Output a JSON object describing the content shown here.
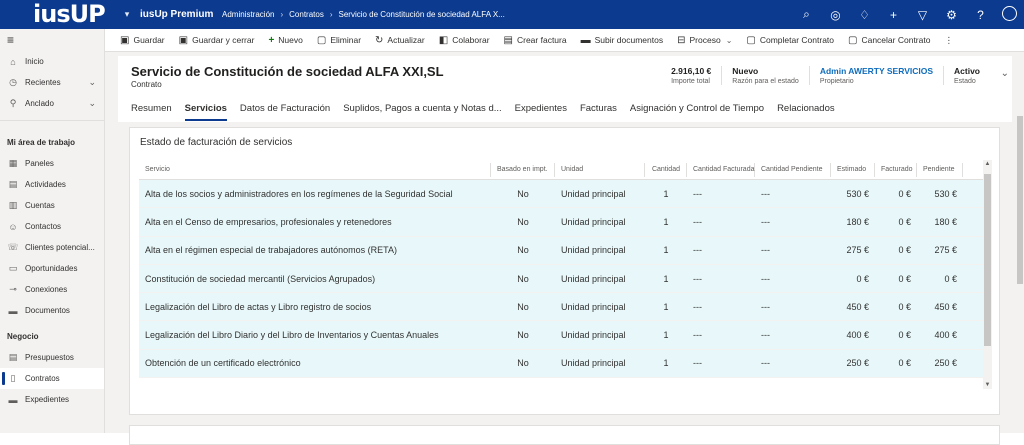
{
  "topbar": {
    "logo": "iusUP",
    "app_name": "iusUp Premium",
    "breadcrumbs": [
      "Administración",
      "Contratos",
      "Servicio de Constitución de sociedad ALFA X..."
    ],
    "icons": [
      "search-icon",
      "target-icon",
      "lightbulb-icon",
      "plus-icon",
      "filter-icon",
      "gear-icon",
      "help-icon",
      "user-icon"
    ]
  },
  "sidebar": {
    "top_items": [
      {
        "label": "Inicio",
        "icon": "home-icon"
      },
      {
        "label": "Recientes",
        "icon": "clock-icon",
        "chevron": true
      },
      {
        "label": "Anclado",
        "icon": "pin-icon",
        "chevron": true
      }
    ],
    "section1": "Mi área de trabajo",
    "work_items": [
      {
        "label": "Paneles",
        "icon": "dashboard-icon"
      },
      {
        "label": "Actividades",
        "icon": "activity-icon"
      },
      {
        "label": "Cuentas",
        "icon": "building-icon"
      },
      {
        "label": "Contactos",
        "icon": "person-icon"
      },
      {
        "label": "Clientes potencial...",
        "icon": "phone-icon"
      },
      {
        "label": "Oportunidades",
        "icon": "document-icon"
      },
      {
        "label": "Conexiones",
        "icon": "connection-icon"
      },
      {
        "label": "Documentos",
        "icon": "folder-icon"
      }
    ],
    "section2": "Negocio",
    "business_items": [
      {
        "label": "Presupuestos",
        "icon": "quote-icon"
      },
      {
        "label": "Contratos",
        "icon": "contract-icon",
        "active": true
      },
      {
        "label": "Expedientes",
        "icon": "folder-icon"
      }
    ]
  },
  "commandbar": [
    {
      "label": "Guardar",
      "icon": "save-icon"
    },
    {
      "label": "Guardar y cerrar",
      "icon": "save-close-icon"
    },
    {
      "label": "Nuevo",
      "icon": "plus-icon"
    },
    {
      "label": "Eliminar",
      "icon": "trash-icon"
    },
    {
      "label": "Actualizar",
      "icon": "refresh-icon"
    },
    {
      "label": "Colaborar",
      "icon": "teams-icon"
    },
    {
      "label": "Crear factura",
      "icon": "invoice-icon"
    },
    {
      "label": "Subir documentos",
      "icon": "upload-icon"
    },
    {
      "label": "Proceso",
      "icon": "process-icon",
      "chevron": true
    },
    {
      "label": "Completar Contrato",
      "icon": "complete-icon"
    },
    {
      "label": "Cancelar Contrato",
      "icon": "cancel-icon"
    }
  ],
  "record": {
    "title": "Servicio de Constitución de sociedad ALFA XXI,SL",
    "entity": "Contrato",
    "kpis": [
      {
        "value": "2.916,10 €",
        "label": "Importe total",
        "link": false
      },
      {
        "value": "Nuevo",
        "label": "Razón para el estado",
        "link": false
      },
      {
        "value": "Admin AWERTY SERVICIOS",
        "label": "Propietario",
        "link": true
      },
      {
        "value": "Activo",
        "label": "Estado",
        "link": false
      }
    ]
  },
  "tabs": [
    "Resumen",
    "Servicios",
    "Datos de Facturación",
    "Suplidos, Pagos a cuenta y Notas d...",
    "Expedientes",
    "Facturas",
    "Asignación y Control de Tiempo",
    "Relacionados"
  ],
  "active_tab": "Servicios",
  "grid": {
    "title": "Estado de facturación de servicios",
    "columns": [
      "Servicio",
      "Basado en impt.",
      "Unidad",
      "Cantidad",
      "Cantidad Facturada",
      "Cantidad Pendiente",
      "Estimado",
      "Facturado",
      "Pendiente"
    ],
    "rows": [
      [
        "Alta de los socios y administradores en los regímenes de la Seguridad Social",
        "No",
        "Unidad principal",
        "1",
        "---",
        "---",
        "530 €",
        "0 €",
        "530 €"
      ],
      [
        "Alta en el Censo de empresarios, profesionales y retenedores",
        "No",
        "Unidad principal",
        "1",
        "---",
        "---",
        "180 €",
        "0 €",
        "180 €"
      ],
      [
        "Alta en el régimen especial de trabajadores autónomos (RETA)",
        "No",
        "Unidad principal",
        "1",
        "---",
        "---",
        "275 €",
        "0 €",
        "275 €"
      ],
      [
        "Constitución de sociedad mercantil (Servicios Agrupados)",
        "No",
        "Unidad principal",
        "1",
        "---",
        "---",
        "0 €",
        "0 €",
        "0 €"
      ],
      [
        "Legalización del Libro de actas y Libro registro de socios",
        "No",
        "Unidad principal",
        "1",
        "---",
        "---",
        "450 €",
        "0 €",
        "450 €"
      ],
      [
        "Legalización del Libro Diario y del Libro de Inventarios y Cuentas Anuales",
        "No",
        "Unidad principal",
        "1",
        "---",
        "---",
        "400 €",
        "0 €",
        "400 €"
      ],
      [
        "Obtención de un certificado electrónico",
        "No",
        "Unidad principal",
        "1",
        "---",
        "---",
        "250 €",
        "0 €",
        "250 €"
      ]
    ]
  }
}
